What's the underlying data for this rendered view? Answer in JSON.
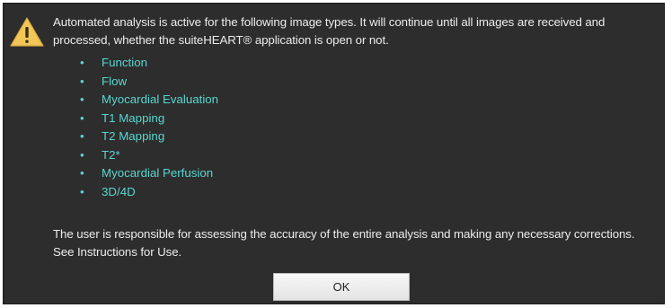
{
  "dialog": {
    "icon": "warning-triangle-icon",
    "message": "Automated analysis is active for the following image types. It will continue until all images are received and processed, whether the suiteHEART® application is open or not.",
    "image_types": [
      "Function",
      "Flow",
      "Myocardial Evaluation",
      "T1 Mapping",
      "T2 Mapping",
      "T2*",
      "Myocardial Perfusion",
      "3D/4D"
    ],
    "bullet": "•",
    "footer": "The user is responsible for assessing the accuracy of the entire analysis and making any necessary corrections. See Instructions for Use.",
    "ok_label": "OK"
  },
  "colors": {
    "background": "#2d2d2d",
    "text": "#ececec",
    "accent": "#58d6d0",
    "warning": "#f1c75a"
  }
}
